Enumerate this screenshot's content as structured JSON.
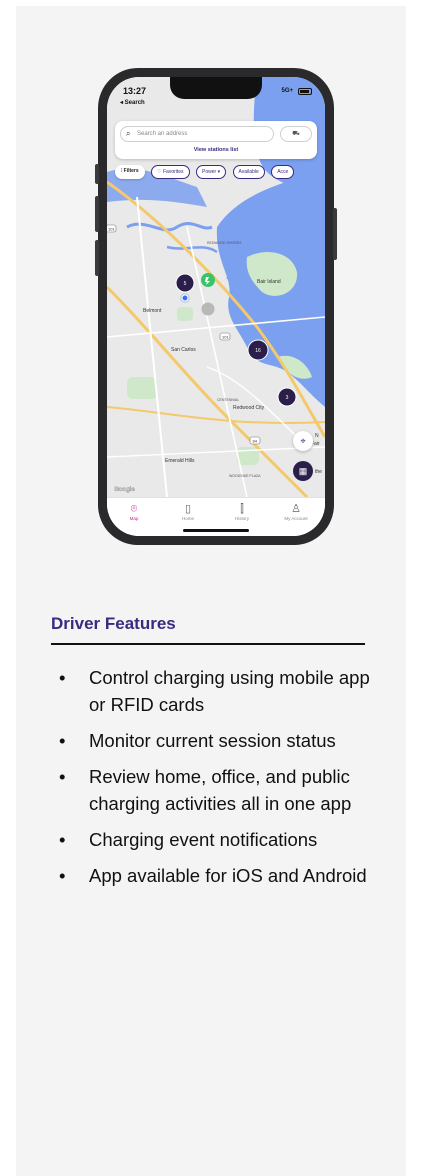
{
  "phone": {
    "status": {
      "time": "13:27",
      "back": "◂ Search",
      "network": "5G+"
    },
    "search": {
      "placeholder": "Search an address",
      "view_list": "View stations list"
    },
    "chips": [
      "Filters",
      "Favorites",
      "Power",
      "Available",
      "Acce"
    ],
    "map_labels": {
      "bair_island": "Bair Island",
      "redwood_shores": "REDWOOD\nSHORES",
      "belmont": "Belmont",
      "san_carlos": "San Carlos",
      "centennial": "CENTENNIAL",
      "redwood_city": "Redwood City",
      "emerald_hills": "Emerald Hills",
      "woodside_plaza": "WOODSIDE\nPLAZA",
      "google": "Google",
      "route_101": "101",
      "route_280": "280",
      "route_84": "84",
      "route_82": "82",
      "route_92": "92",
      "edge_n": "N",
      "edge_fair": "Fair",
      "edge_the": "the"
    },
    "clusters": [
      {
        "label": "5"
      },
      {
        "label": "16"
      },
      {
        "label": "3"
      }
    ],
    "tabs": [
      {
        "label": "Map",
        "icon": "map-pin-icon"
      },
      {
        "label": "Home",
        "icon": "charger-icon"
      },
      {
        "label": "History",
        "icon": "history-chart-icon"
      },
      {
        "label": "My Account",
        "icon": "user-icon"
      }
    ],
    "colors": {
      "accent": "#3b2a80",
      "active_tab": "#c22a9c",
      "water": "#7aa0ef",
      "land": "#e9e9e9",
      "park": "#cfe8c9"
    }
  },
  "features": {
    "heading": "Driver Features",
    "items": [
      "Control charging using mobile app or RFID cards",
      "Monitor current session status",
      "Review home, office, and public charging activities all in one app",
      "Charging event notifications",
      "App available for iOS and Android"
    ]
  }
}
